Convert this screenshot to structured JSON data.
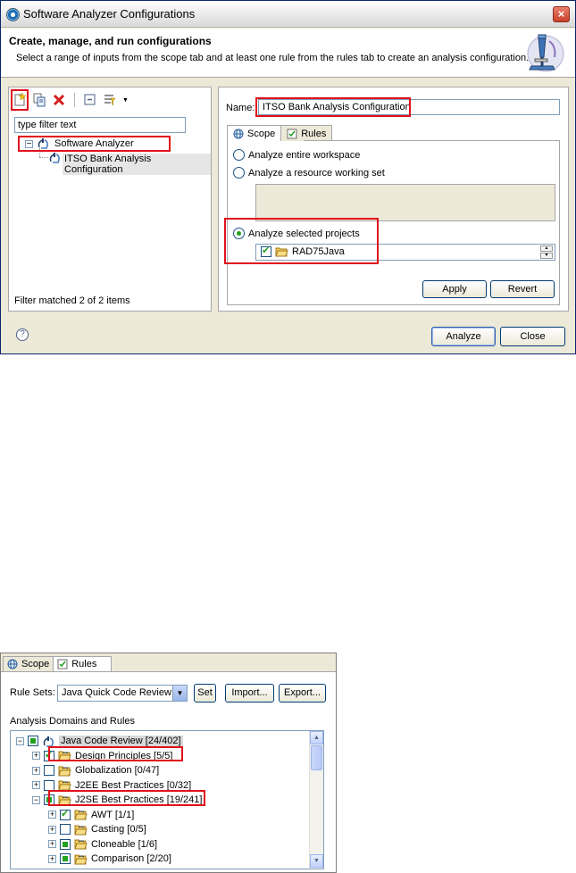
{
  "dialog": {
    "title": "Software Analyzer Configurations",
    "close_glyph": "×",
    "header_title": "Create, manage, and run configurations",
    "header_desc": "Select a range of inputs from the scope tab and at least one rule from the rules tab to create an analysis configuration.",
    "banner_icon": "microscope-icon"
  },
  "left": {
    "toolbar_icons": [
      "new-config-icon",
      "duplicate-icon",
      "delete-icon",
      "collapse-all-icon",
      "filter-icon"
    ],
    "filter_placeholder": "type filter text",
    "tree_root": "Software Analyzer",
    "tree_child": "ITSO Bank Analysis Configuration",
    "filter_status": "Filter matched 2 of 2 items"
  },
  "right": {
    "name_label": "Name:",
    "name_value": "ITSO Bank Analysis Configuration",
    "tabs": [
      "Scope",
      "Rules"
    ],
    "scope_options": [
      "Analyze entire workspace",
      "Analyze a resource working set",
      "Analyze selected projects"
    ],
    "selected_option_index": 2,
    "project": "RAD75Java",
    "apply": "Apply",
    "revert": "Revert"
  },
  "footer": {
    "help_glyph": "?",
    "analyze": "Analyze",
    "close": "Close"
  },
  "rules_panel": {
    "tabs": [
      "Scope",
      "Rules"
    ],
    "rule_sets_label": "Rule Sets:",
    "rule_set_value": "Java Quick Code Review",
    "set": "Set",
    "import": "Import...",
    "export": "Export...",
    "domains_label": "Analysis Domains and Rules",
    "tree": [
      {
        "label": "Java Code Review [24/402]",
        "level": 0,
        "expander": "−",
        "check": "partial"
      },
      {
        "label": "Design Principles [5/5]",
        "level": 1,
        "expander": "+",
        "check": "checked"
      },
      {
        "label": "Globalization [0/47]",
        "level": 1,
        "expander": "+",
        "check": "none"
      },
      {
        "label": "J2EE Best Practices [0/32]",
        "level": 1,
        "expander": "+",
        "check": "none"
      },
      {
        "label": "J2SE Best Practices [19/241]",
        "level": 1,
        "expander": "−",
        "check": "partial"
      },
      {
        "label": "AWT [1/1]",
        "level": 2,
        "expander": "+",
        "check": "checked"
      },
      {
        "label": "Casting [0/5]",
        "level": 2,
        "expander": "+",
        "check": "none"
      },
      {
        "label": "Cloneable [1/6]",
        "level": 2,
        "expander": "+",
        "check": "partial"
      },
      {
        "label": "Comparison [2/20]",
        "level": 2,
        "expander": "+",
        "check": "partial"
      }
    ]
  },
  "colors": {
    "highlight_box": "#e0111c",
    "check_green": "#21a121",
    "dialog_bg": "#ece9d8"
  }
}
